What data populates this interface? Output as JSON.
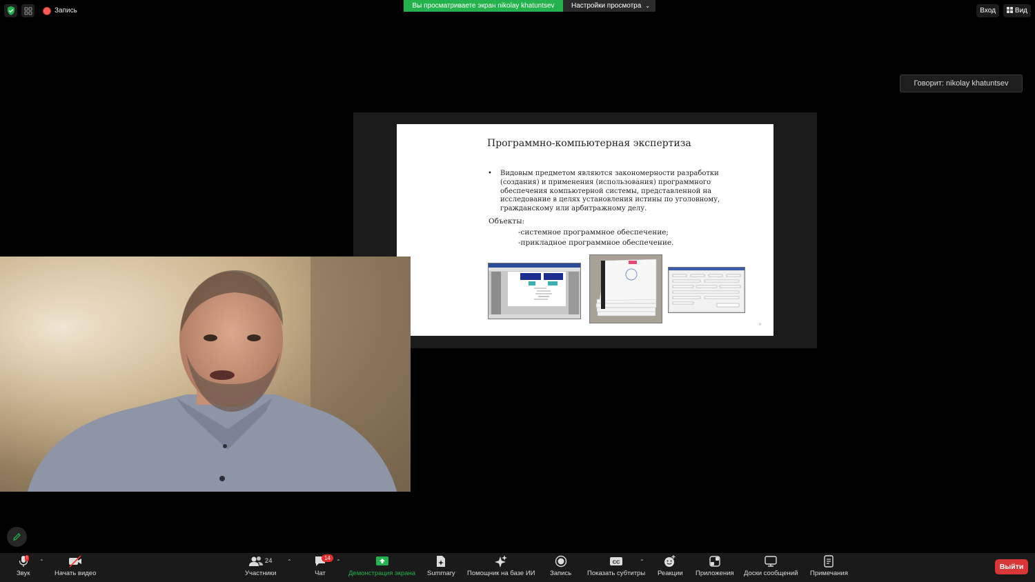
{
  "top_bar": {
    "record_label": "Запись",
    "share_banner": "Вы просматриваете экран nikolay khatuntsev",
    "view_settings": "Настройки просмотра",
    "login": "Вход",
    "view": "Вид"
  },
  "speaker": "Говорит: nikolay khatuntsev",
  "slide": {
    "title": "Программно-компьютерная экспертиза",
    "bullet": "Видовым предметом являются закономерности разработки (создания) и применения (использования) программного обеспечения компьютерной системы, представленной на исследование в целях установления истины по уголовному, гражданскому или арбитражному делу.",
    "objects_label": "Объекты:",
    "objects": [
      "-системное программное обеспечение;",
      "-прикладное программное обеспечение."
    ],
    "page_number": "9"
  },
  "toolbar": {
    "audio": "Звук",
    "video": "Начать видео",
    "participants": "Участники",
    "participants_count": "24",
    "chat": "Чат",
    "chat_badge": "14",
    "share": "Демонстрация экрана",
    "summary": "Summary",
    "ai": "Помощник на базе ИИ",
    "record": "Запись",
    "captions": "Показать субтитры",
    "reactions": "Реакции",
    "apps": "Приложения",
    "whiteboards": "Доски сообщений",
    "notes": "Примечания",
    "exit": "Выйти"
  },
  "colors": {
    "share_green": "#23b24b",
    "exit_red": "#d93737",
    "badge_red": "#e52b2b"
  }
}
